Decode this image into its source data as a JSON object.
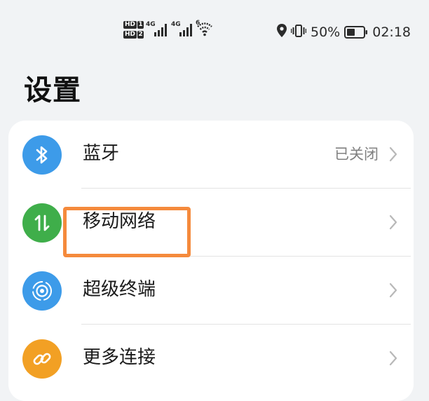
{
  "status_bar": {
    "sim1_badge": "HD",
    "sim1_number": "1",
    "sim2_badge": "HD",
    "sim2_number": "2",
    "sim1_network": "4G",
    "sim2_network": "4G",
    "wifi_label": "6",
    "battery_percent": "50%",
    "time": "02:18",
    "icons": [
      "location-icon",
      "vibrate-icon",
      "battery-icon",
      "wifi-icon",
      "signal-icon"
    ]
  },
  "page": {
    "title": "设置"
  },
  "settings": {
    "items": [
      {
        "label": "蓝牙",
        "value": "已关闭",
        "icon": "bluetooth-icon",
        "color": "#3d9be9"
      },
      {
        "label": "移动网络",
        "value": "",
        "icon": "mobile-data-icon",
        "color": "#3fae4a"
      },
      {
        "label": "超级终端",
        "value": "",
        "icon": "super-device-icon",
        "color": "#3d9be9"
      },
      {
        "label": "更多连接",
        "value": "",
        "icon": "link-icon",
        "color": "#f2a024"
      }
    ]
  },
  "annotation": {
    "highlight_color": "#f58a3c"
  }
}
